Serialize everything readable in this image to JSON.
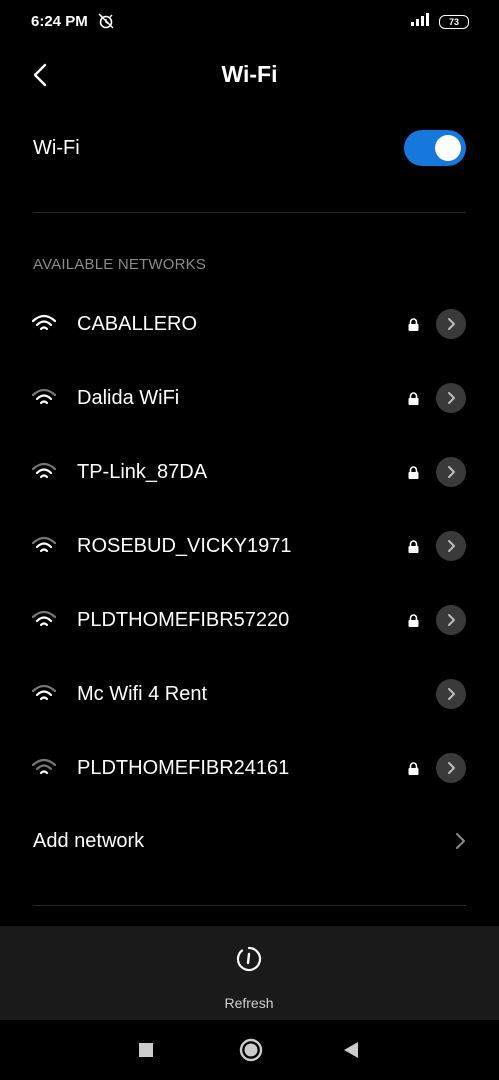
{
  "status_bar": {
    "time": "6:24 PM",
    "battery": "73"
  },
  "header": {
    "title": "Wi-Fi"
  },
  "wifi_toggle": {
    "label": "Wi-Fi",
    "state": "on",
    "accent_color": "#1677dd"
  },
  "available_networks": {
    "label": "AVAILABLE NETWORKS",
    "networks": [
      {
        "name": "CABALLERO",
        "secured": true,
        "signal": "strong"
      },
      {
        "name": "Dalida WiFi",
        "secured": true,
        "signal": "medium"
      },
      {
        "name": "TP-Link_87DA",
        "secured": true,
        "signal": "medium"
      },
      {
        "name": "ROSEBUD_VICKY1971",
        "secured": true,
        "signal": "medium"
      },
      {
        "name": "PLDTHOMEFIBR57220",
        "secured": true,
        "signal": "medium"
      },
      {
        "name": "Mc Wifi 4 Rent",
        "secured": false,
        "signal": "medium"
      },
      {
        "name": "PLDTHOMEFIBR24161",
        "secured": true,
        "signal": "weak"
      }
    ]
  },
  "add_network": {
    "label": "Add network"
  },
  "toolbar": {
    "refresh_label": "Refresh"
  },
  "icons": {
    "back": "back-arrow-icon",
    "wifi": "wifi-signal-icon",
    "lock": "lock-icon",
    "info": "chevron-right-icon",
    "refresh": "refresh-icon",
    "nav_recent": "square-icon",
    "nav_home": "circle-icon",
    "nav_back": "triangle-icon"
  }
}
